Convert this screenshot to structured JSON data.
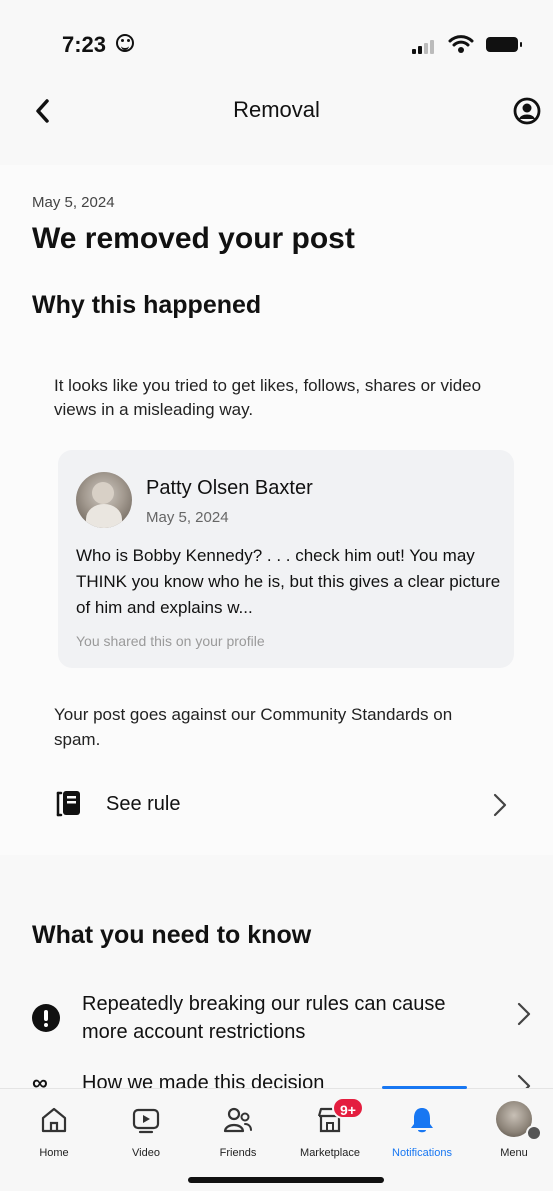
{
  "status_bar": {
    "time": "7:23"
  },
  "header": {
    "title": "Removal"
  },
  "content": {
    "date": "May 5, 2024",
    "headline": "We removed your post",
    "why_heading": "Why this happened",
    "explanation": "It looks like you tried to get likes, follows, shares or video views in a misleading way.",
    "post": {
      "author": "Patty Olsen Baxter",
      "date": "May 5, 2024",
      "text": "Who is Bobby Kennedy? . . . check him out! You may THINK you know who he is, but this gives a clear picture of him and explains w...",
      "shared_note": "You shared this on your profile"
    },
    "violation": "Your post goes against our Community Standards on spam.",
    "see_rule_label": "See rule",
    "know_heading": "What you need to know",
    "know_items": [
      {
        "label": "Repeatedly breaking our rules can cause more account restrictions",
        "icon": "alert-circle-icon"
      },
      {
        "label": "How we made this decision",
        "icon": "infinity-icon"
      }
    ]
  },
  "tabbar": {
    "accent": "#1877f2",
    "badge_color": "#e41e3f",
    "marketplace_badge": "9+",
    "tabs": [
      {
        "label": "Home",
        "icon": "home-icon"
      },
      {
        "label": "Video",
        "icon": "video-icon"
      },
      {
        "label": "Friends",
        "icon": "friends-icon"
      },
      {
        "label": "Marketplace",
        "icon": "marketplace-icon"
      },
      {
        "label": "Notifications",
        "icon": "bell-icon",
        "active": true
      },
      {
        "label": "Menu",
        "icon": "avatar"
      }
    ]
  }
}
